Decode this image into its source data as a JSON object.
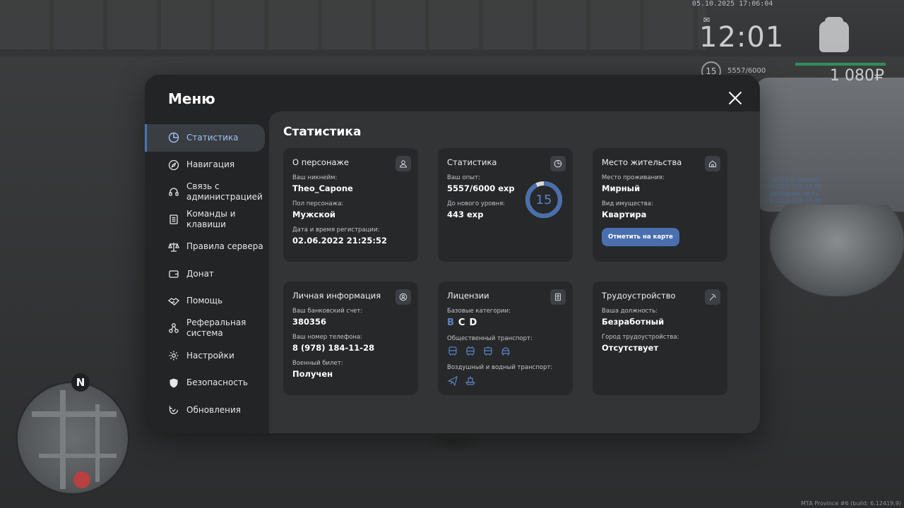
{
  "hud": {
    "datetime": "05.10.2025 17:06:04",
    "time": "12:01",
    "level": "15",
    "exp": "5557/6000",
    "money": "1 080₽",
    "build": "MTA Province #6 (build: 6.12419.9)"
  },
  "minimap": {
    "north": "N"
  },
  "car_label": "Телефон доверия\n8 (222) 555-12-62\nДежурная часть\n8 (222) 555-55-48",
  "menu": {
    "title": "Меню",
    "sidebar": [
      {
        "label": "Статистика",
        "icon": "pie-chart-icon",
        "active": true
      },
      {
        "label": "Навигация",
        "icon": "compass-icon"
      },
      {
        "label": "Связь с\nадминистрацией",
        "icon": "headset-icon"
      },
      {
        "label": "Команды и\nклавиши",
        "icon": "document-icon"
      },
      {
        "label": "Правила сервера",
        "icon": "scales-icon"
      },
      {
        "label": "Донат",
        "icon": "wallet-icon"
      },
      {
        "label": "Помощь",
        "icon": "handshake-icon"
      },
      {
        "label": "Реферальная\nсистема",
        "icon": "network-icon"
      },
      {
        "label": "Настройки",
        "icon": "gear-icon"
      },
      {
        "label": "Безопасность",
        "icon": "shield-icon"
      },
      {
        "label": "Обновления",
        "icon": "refresh-icon"
      }
    ],
    "content_title": "Статистика",
    "cards": {
      "character": {
        "title": "О персонаже",
        "nickname_label": "Ваш никнейм:",
        "nickname": "Theo_Capone",
        "gender_label": "Пол персонажа:",
        "gender": "Мужской",
        "reg_label": "Дата и время регистрации:",
        "reg": "02.06.2022 21:25:52"
      },
      "stats": {
        "title": "Статистика",
        "exp_label": "Ваш опыт:",
        "exp": "5557/6000 exp",
        "next_label": "До нового уровня:",
        "next": "443 exp",
        "level": "15",
        "progress": 0.926
      },
      "residence": {
        "title": "Место жительства",
        "place_label": "Место проживания:",
        "place": "Мирный",
        "property_label": "Вид имущества:",
        "property": "Квартира",
        "button": "Отметить на карте"
      },
      "personal": {
        "title": "Личная информация",
        "bank_label": "Ваш банковский счет:",
        "bank": "380356",
        "phone_label": "Ваш номер телефона:",
        "phone": "8 (978) 184-11-28",
        "military_label": "Военный билет:",
        "military": "Получен"
      },
      "licenses": {
        "title": "Лицензии",
        "base_label": "Базовые категории:",
        "categories": [
          "B",
          "C",
          "D"
        ],
        "public_label": "Общественный транспорт:",
        "air_label": "Воздушный и водный транспорт:"
      },
      "employment": {
        "title": "Трудоустройство",
        "position_label": "Ваша должность:",
        "position": "Безработный",
        "city_label": "Город трудоустройства:",
        "city": "Отсутствует"
      }
    }
  },
  "colors": {
    "accent": "#4a74b8",
    "accent_text": "#9fc0f0",
    "panel": "#232425",
    "card": "#26282a"
  }
}
